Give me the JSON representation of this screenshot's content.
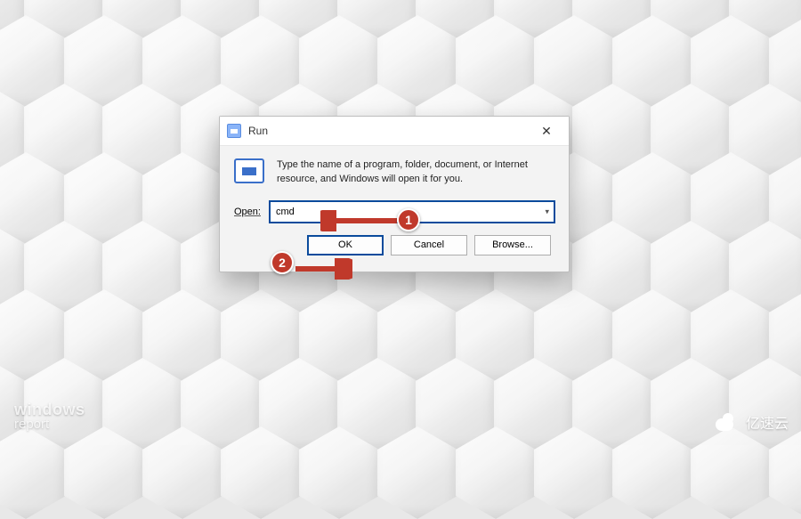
{
  "dialog": {
    "title": "Run",
    "description": "Type the name of a program, folder, document, or Internet resource, and Windows will open it for you.",
    "open_label": "Open:",
    "open_value": "cmd",
    "buttons": {
      "ok": "OK",
      "cancel": "Cancel",
      "browse": "Browse..."
    }
  },
  "annotations": {
    "step1": "1",
    "step2": "2"
  },
  "watermarks": {
    "left_line1": "windows",
    "left_line2": "report",
    "right": "亿速云"
  },
  "icons": {
    "run_small": "run-icon",
    "run_large": "run-icon",
    "close": "close-icon",
    "chevron_down": "chevron-down-icon",
    "cloud": "cloud-icon"
  },
  "colors": {
    "accent": "#0a4b9c",
    "annotation": "#c0392b"
  }
}
